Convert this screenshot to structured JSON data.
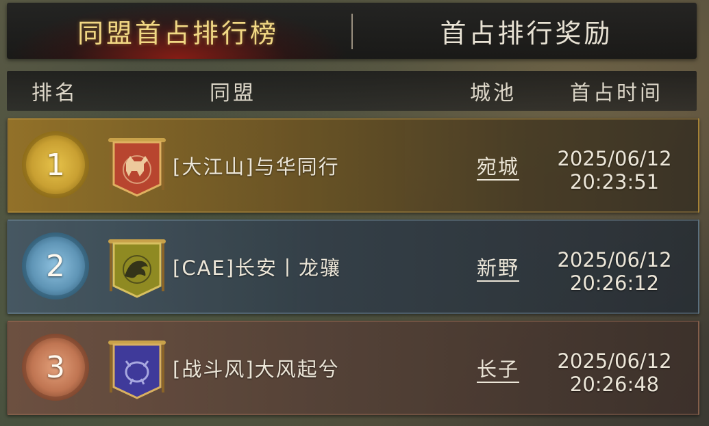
{
  "tabs": {
    "active_label": "同盟首占排行榜",
    "inactive_label": "首占排行奖励"
  },
  "header": {
    "rank": "排名",
    "alliance": "同盟",
    "city": "城池",
    "time": "首占时间"
  },
  "rows": [
    {
      "rank": "1",
      "alliance": "[大江山]与华同行",
      "city": "宛城",
      "date": "2025/06/12",
      "time": "20:23:51",
      "medal": "gold",
      "banner_icon": "red-deer-banner-icon",
      "banner_color": "#b8452f"
    },
    {
      "rank": "2",
      "alliance": "[CAE]长安丨龙骧",
      "city": "新野",
      "date": "2025/06/12",
      "time": "20:26:12",
      "medal": "silver",
      "banner_icon": "yellow-dragon-banner-icon",
      "banner_color": "#8f8a22"
    },
    {
      "rank": "3",
      "alliance": "[战斗风]大风起兮",
      "city": "长子",
      "date": "2025/06/12",
      "time": "20:26:48",
      "medal": "bronze",
      "banner_icon": "purple-beast-banner-icon",
      "banner_color": "#3f3a9a"
    }
  ]
}
